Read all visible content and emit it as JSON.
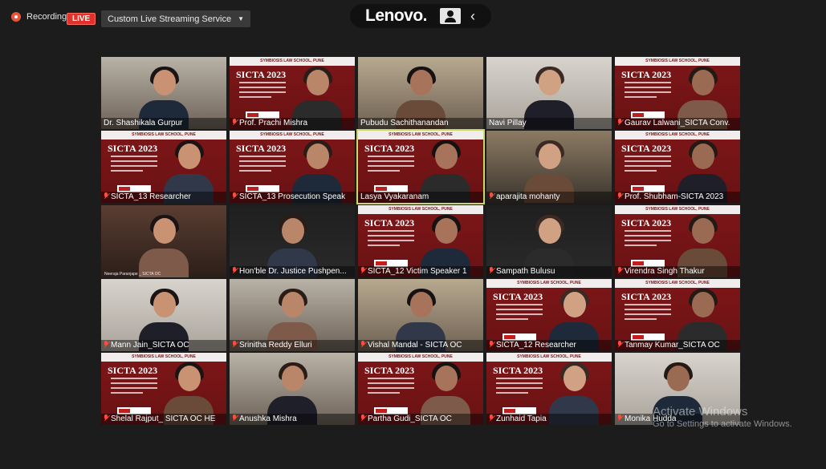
{
  "recording": {
    "label": "Recording",
    "live_badge": "LIVE",
    "stream_service": "Custom Live Streaming Service"
  },
  "brand": {
    "name": "Lenovo."
  },
  "participants": [
    {
      "name": "Dr. Shashikala Gurpur",
      "bg": "room"
    },
    {
      "name": "Prof. Prachi Mishra",
      "bg": "sicta",
      "muted": true
    },
    {
      "name": "Pubudu Sachithanandan",
      "bg": "shelf"
    },
    {
      "name": "Navi Pillay",
      "bg": "light"
    },
    {
      "name": "Gaurav Lalwani_SICTA Conv.",
      "bg": "sicta",
      "muted": true
    },
    {
      "name": "SICTA_13 Researcher",
      "bg": "sicta",
      "muted": true
    },
    {
      "name": "SICTA_13 Prosecution Speak",
      "bg": "sicta",
      "muted": true
    },
    {
      "name": "Lasya Vyakaranam",
      "bg": "sicta",
      "active": true
    },
    {
      "name": "aparajita mohanty",
      "bg": "office",
      "muted": true
    },
    {
      "name": "Prof. Shubham-SICTA 2023",
      "bg": "sicta",
      "muted": true
    },
    {
      "name": "",
      "bg": "hall",
      "nameplate": "Neeraja Paranjape _ SICTA OC"
    },
    {
      "name": "Hon'ble Dr. Justice Pushpen...",
      "bg": "dark",
      "muted": true
    },
    {
      "name": "SICTA_12 Victim Speaker 1",
      "bg": "sicta",
      "muted": true
    },
    {
      "name": "Sampath Bulusu",
      "bg": "dark",
      "muted": true
    },
    {
      "name": "Virendra Singh Thakur",
      "bg": "sicta",
      "muted": true
    },
    {
      "name": "Mann Jain_SICTA OC",
      "bg": "light",
      "muted": true
    },
    {
      "name": "Srinitha Reddy Elluri",
      "bg": "room",
      "muted": true
    },
    {
      "name": "Vishal Mandal - SICTA OC",
      "bg": "shelf",
      "muted": true
    },
    {
      "name": "SICTA_12 Researcher",
      "bg": "sicta",
      "muted": true
    },
    {
      "name": "Tanmay Kumar_SICTA OC",
      "bg": "sicta",
      "muted": true
    },
    {
      "name": "Shelal Rajput_ SICTA OC HE",
      "bg": "sicta",
      "muted": true
    },
    {
      "name": "Anushka Mishra",
      "bg": "room",
      "muted": true
    },
    {
      "name": "Partha Gudi_SICTA OC",
      "bg": "sicta",
      "muted": true
    },
    {
      "name": "Zunhaid Tapia",
      "bg": "sicta",
      "muted": true
    },
    {
      "name": "Monika Hudda",
      "bg": "light",
      "muted": true
    }
  ],
  "slide": {
    "header": "SYMBIOSIS LAW SCHOOL, PUNE",
    "title": "SICTA 2023"
  },
  "watermark": {
    "title": "Activate Windows",
    "subtitle": "Go to Settings to activate Windows."
  }
}
